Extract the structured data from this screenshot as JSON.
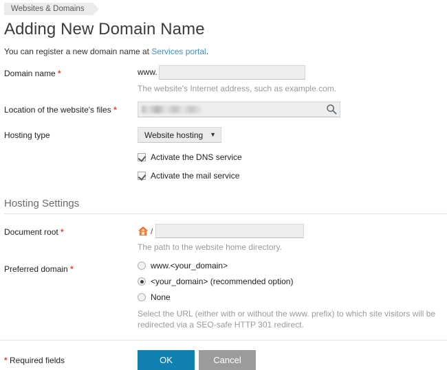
{
  "breadcrumb": {
    "label": "Websites & Domains"
  },
  "page": {
    "title": "Adding New Domain Name",
    "intro_before": "You can register a new domain name at ",
    "intro_link": "Services portal",
    "intro_after": "."
  },
  "form": {
    "domain_name": {
      "label": "Domain name",
      "required_mark": "*",
      "prefix": "www.",
      "value": "",
      "placeholder": "",
      "hint": "The website's Internet address, such as example.com."
    },
    "location": {
      "label": "Location of the website's files",
      "required_mark": "*",
      "value": "",
      "placeholder": "",
      "icon": "search-icon"
    },
    "hosting_type": {
      "label": "Hosting type",
      "selected": "Website hosting",
      "caret": "▼",
      "options": [
        "Website hosting"
      ]
    },
    "dns_service": {
      "label": "Activate the DNS service",
      "checked": true
    },
    "mail_service": {
      "label": "Activate the mail service",
      "checked": true
    }
  },
  "hosting_settings": {
    "section_title": "Hosting Settings",
    "document_root": {
      "label": "Document root",
      "required_mark": "*",
      "icon": "home-icon",
      "separator": "/",
      "value": "",
      "placeholder": "",
      "hint": "The path to the website home directory."
    },
    "preferred_domain": {
      "label": "Preferred domain",
      "required_mark": "*",
      "options": [
        {
          "label": "www.<your_domain>",
          "selected": false
        },
        {
          "label": "<your_domain> (recommended option)",
          "selected": true
        },
        {
          "label": "None",
          "selected": false
        }
      ],
      "hint": "Select the URL (either with or without the www. prefix) to which site visitors will be redirected via a SEO-safe HTTP 301 redirect."
    }
  },
  "footer": {
    "required_note_mark": "*",
    "required_note": " Required fields",
    "ok_label": "OK",
    "cancel_label": "Cancel"
  },
  "colors": {
    "accent_blue": "#1080b0",
    "link_blue": "#3c8fd0",
    "required_red": "#e8432c",
    "cancel_gray": "#9b9b9b",
    "breadcrumb_bg": "#ebebeb"
  }
}
